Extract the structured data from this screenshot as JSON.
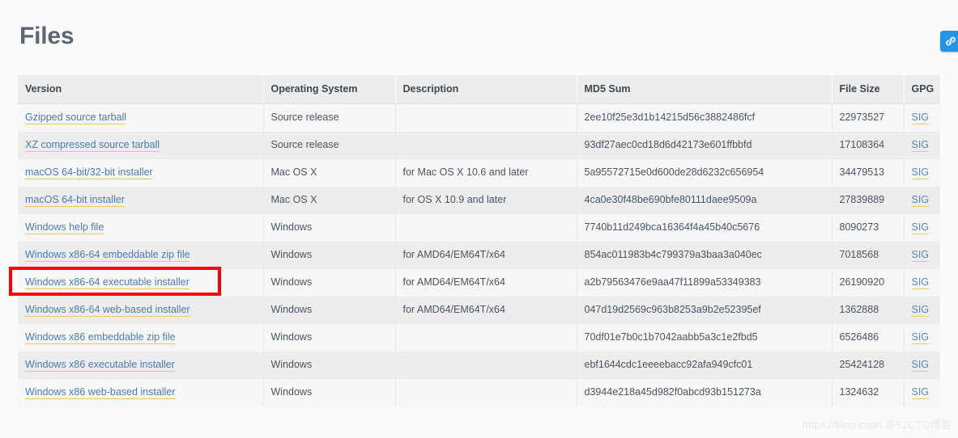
{
  "page": {
    "title": "Files",
    "watermark_left": "https://blog.csdn.",
    "watermark_right": "@51CTO博客",
    "accent_blue": "#2196e8",
    "link_color": "#4b7baa",
    "link_underline_color": "#f2c75c",
    "annotation_color": "#ff0000",
    "header_bg": "#ededed",
    "row_odd_bg": "#f7f7f7",
    "row_even_bg": "#ededed"
  },
  "link_badge": {
    "icon": "link-chain-icon",
    "label": "Permalink"
  },
  "table": {
    "columns": [
      {
        "key": "version",
        "label": "Version"
      },
      {
        "key": "os",
        "label": "Operating System"
      },
      {
        "key": "description",
        "label": "Description"
      },
      {
        "key": "md5",
        "label": "MD5 Sum"
      },
      {
        "key": "size",
        "label": "File Size"
      },
      {
        "key": "gpg",
        "label": "GPG"
      }
    ],
    "sig_label": "SIG",
    "rows": [
      {
        "version": "Gzipped source tarball",
        "os": "Source release",
        "description": "",
        "md5": "2ee10f25e3d1b14215d56c3882486fcf",
        "size": "22973527",
        "gpg": "SIG",
        "highlighted": false
      },
      {
        "version": "XZ compressed source tarball",
        "os": "Source release",
        "description": "",
        "md5": "93df27aec0cd18d6d42173e601ffbbfd",
        "size": "17108364",
        "gpg": "SIG",
        "highlighted": false
      },
      {
        "version": "macOS 64-bit/32-bit installer",
        "os": "Mac OS X",
        "description": "for Mac OS X 10.6 and later",
        "md5": "5a95572715e0d600de28d6232c656954",
        "size": "34479513",
        "gpg": "SIG",
        "highlighted": false
      },
      {
        "version": "macOS 64-bit installer",
        "os": "Mac OS X",
        "description": "for OS X 10.9 and later",
        "md5": "4ca0e30f48be690bfe80111daee9509a",
        "size": "27839889",
        "gpg": "SIG",
        "highlighted": false
      },
      {
        "version": "Windows help file",
        "os": "Windows",
        "description": "",
        "md5": "7740b11d249bca16364f4a45b40c5676",
        "size": "8090273",
        "gpg": "SIG",
        "highlighted": false
      },
      {
        "version": "Windows x86-64 embeddable zip file",
        "os": "Windows",
        "description": "for AMD64/EM64T/x64",
        "md5": "854ac011983b4c799379a3baa3a040ec",
        "size": "7018568",
        "gpg": "SIG",
        "highlighted": false
      },
      {
        "version": "Windows x86-64 executable installer",
        "os": "Windows",
        "description": "for AMD64/EM64T/x64",
        "md5": "a2b79563476e9aa47f11899a53349383",
        "size": "26190920",
        "gpg": "SIG",
        "highlighted": true
      },
      {
        "version": "Windows x86-64 web-based installer",
        "os": "Windows",
        "description": "for AMD64/EM64T/x64",
        "md5": "047d19d2569c963b8253a9b2e52395ef",
        "size": "1362888",
        "gpg": "SIG",
        "highlighted": false
      },
      {
        "version": "Windows x86 embeddable zip file",
        "os": "Windows",
        "description": "",
        "md5": "70df01e7b0c1b7042aabb5a3c1e2fbd5",
        "size": "6526486",
        "gpg": "SIG",
        "highlighted": false
      },
      {
        "version": "Windows x86 executable installer",
        "os": "Windows",
        "description": "",
        "md5": "ebf1644cdc1eeeebacc92afa949cfc01",
        "size": "25424128",
        "gpg": "SIG",
        "highlighted": false
      },
      {
        "version": "Windows x86 web-based installer",
        "os": "Windows",
        "description": "",
        "md5": "d3944e218a45d982f0abcd93b151273a",
        "size": "1324632",
        "gpg": "SIG",
        "highlighted": false
      }
    ]
  }
}
